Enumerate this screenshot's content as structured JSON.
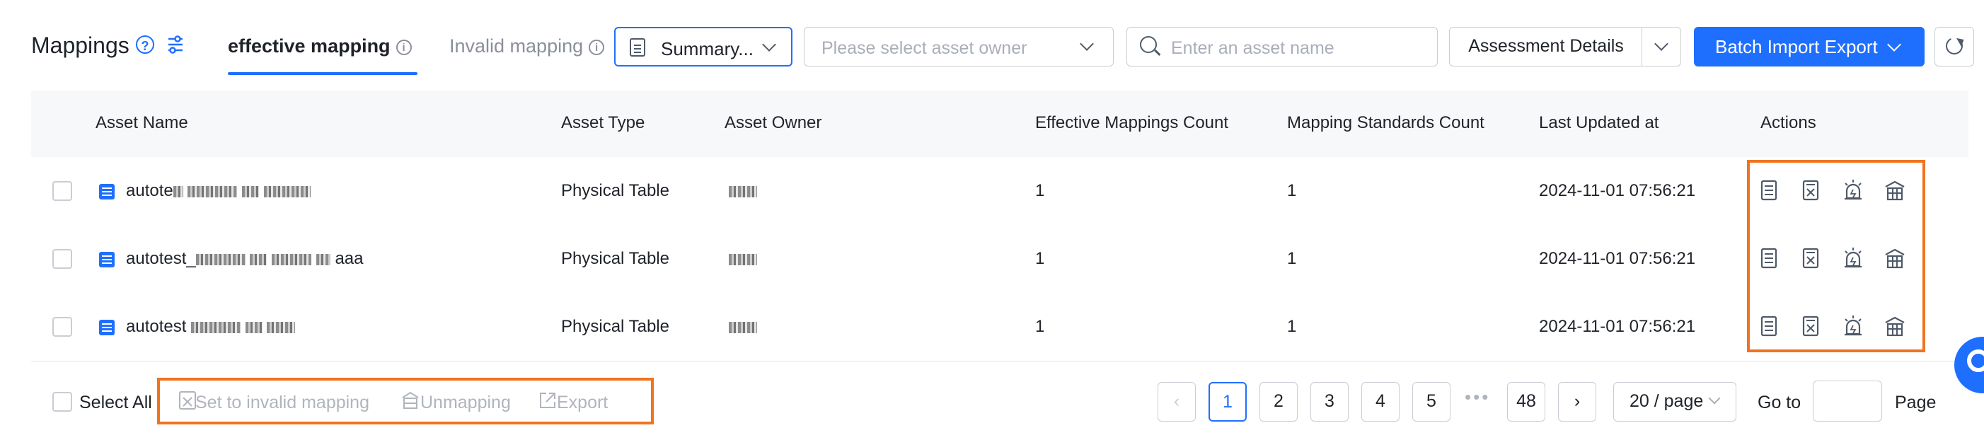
{
  "header": {
    "title": "Mappings",
    "tabs": [
      {
        "label": "effective mapping",
        "active": true
      },
      {
        "label": "Invalid mapping",
        "active": false
      }
    ],
    "summary_select": "Summary...",
    "owner_placeholder": "Please select asset owner",
    "search_placeholder": "Enter an asset name",
    "assessment_button": "Assessment Details",
    "batch_button": "Batch Import Export"
  },
  "table": {
    "columns": [
      "Asset Name",
      "Asset Type",
      "Asset Owner",
      "Effective Mappings Count",
      "Mapping Standards Count",
      "Last Updated at",
      "Actions"
    ],
    "rows": [
      {
        "name": "autote",
        "type": "Physical Table",
        "effective": "1",
        "standards": "1",
        "updated": "2024-11-01 07:56:21"
      },
      {
        "name": "autotest_",
        "suffix": "aaa",
        "type": "Physical Table",
        "effective": "1",
        "standards": "1",
        "updated": "2024-11-01 07:56:21"
      },
      {
        "name": "autotest",
        "type": "Physical Table",
        "effective": "1",
        "standards": "1",
        "updated": "2024-11-01 07:56:21"
      }
    ]
  },
  "footer": {
    "select_all": "Select All",
    "bulk_actions": [
      "Set to invalid mapping",
      "Unmapping",
      "Export"
    ],
    "pages": [
      "1",
      "2",
      "3",
      "4",
      "5"
    ],
    "ellipsis": "•••",
    "last_page": "48",
    "current_page": 1,
    "page_size": "20 / page",
    "goto_label": "Go to",
    "page_label": "Page"
  },
  "colors": {
    "primary": "#1f6fff",
    "highlight": "#f0741f"
  }
}
